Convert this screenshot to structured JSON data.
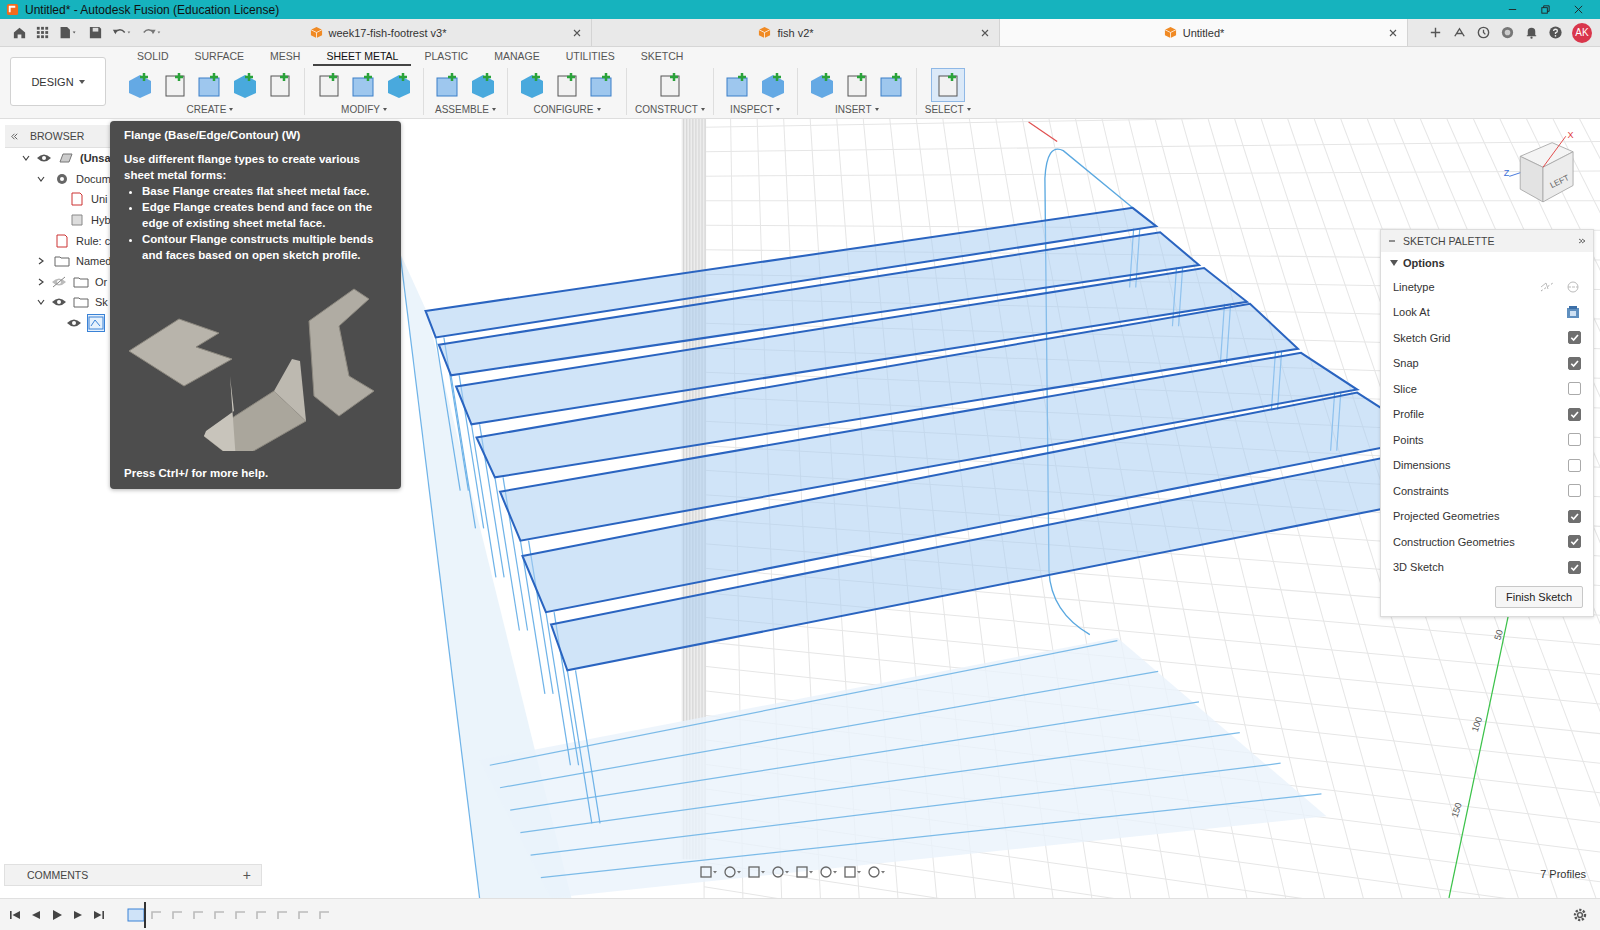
{
  "window": {
    "title": "Untitled* - Autodesk Fusion (Education License)"
  },
  "doc_tabs": [
    {
      "label": "week17-fish-footrest v3*",
      "selected": false
    },
    {
      "label": "fish v2*",
      "selected": false
    },
    {
      "label": "Untitled*",
      "selected": true
    }
  ],
  "user": {
    "initials": "AK"
  },
  "workspace": {
    "label": "DESIGN"
  },
  "toolbar_tabs": [
    {
      "label": "SOLID",
      "selected": false
    },
    {
      "label": "SURFACE",
      "selected": false
    },
    {
      "label": "MESH",
      "selected": false
    },
    {
      "label": "SHEET METAL",
      "selected": true
    },
    {
      "label": "PLASTIC",
      "selected": false
    },
    {
      "label": "MANAGE",
      "selected": false
    },
    {
      "label": "UTILITIES",
      "selected": false
    },
    {
      "label": "SKETCH",
      "selected": false
    }
  ],
  "tool_groups": [
    "CREATE",
    "MODIFY",
    "ASSEMBLE",
    "CONFIGURE",
    "CONSTRUCT",
    "INSPECT",
    "INSERT",
    "SELECT"
  ],
  "browser": {
    "title": "BROWSER",
    "items": [
      {
        "label": "(Unsa",
        "depth": 0,
        "expandable": true,
        "expanded": true,
        "eye": "shown",
        "kind": "component"
      },
      {
        "label": "Docum",
        "depth": 1,
        "expandable": true,
        "expanded": true,
        "eye": "none",
        "kind": "settings"
      },
      {
        "label": "Uni",
        "depth": 2,
        "expandable": false,
        "expanded": false,
        "eye": "none",
        "kind": "units"
      },
      {
        "label": "Hyb",
        "depth": 2,
        "expandable": false,
        "expanded": false,
        "eye": "none",
        "kind": "hybrid"
      },
      {
        "label": "Rule: c",
        "depth": 1,
        "expandable": false,
        "expanded": false,
        "eye": "none",
        "kind": "rule"
      },
      {
        "label": "Named",
        "depth": 1,
        "expandable": true,
        "expanded": false,
        "eye": "none",
        "kind": "folder"
      },
      {
        "label": "Or",
        "depth": 1,
        "expandable": true,
        "expanded": false,
        "eye": "hidden",
        "kind": "folder"
      },
      {
        "label": "Sk",
        "depth": 1,
        "expandable": true,
        "expanded": true,
        "eye": "shown",
        "kind": "folder"
      },
      {
        "label": "",
        "depth": 2,
        "expandable": false,
        "expanded": false,
        "eye": "shown",
        "kind": "sketch"
      }
    ]
  },
  "tooltip": {
    "title": "Flange (Base/Edge/Contour) (W)",
    "intro": "Use different flange types to create various sheet metal forms:",
    "bullets": [
      "Base Flange creates flat sheet metal face.",
      "Edge Flange creates bend and face on the edge of existing sheet metal face.",
      "Contour Flange constructs multiple bends and faces based on open sketch profile."
    ],
    "footer": "Press Ctrl+/ for more help."
  },
  "sketch_palette": {
    "title": "SKETCH PALETTE",
    "section": "Options",
    "section_expanded": true,
    "rows": [
      {
        "label": "Linetype",
        "kind": "icons"
      },
      {
        "label": "Look At",
        "kind": "button"
      },
      {
        "label": "Sketch Grid",
        "kind": "checkbox",
        "checked": true
      },
      {
        "label": "Snap",
        "kind": "checkbox",
        "checked": true
      },
      {
        "label": "Slice",
        "kind": "checkbox",
        "checked": false
      },
      {
        "label": "Profile",
        "kind": "checkbox",
        "checked": true
      },
      {
        "label": "Points",
        "kind": "checkbox",
        "checked": false
      },
      {
        "label": "Dimensions",
        "kind": "checkbox",
        "checked": false
      },
      {
        "label": "Constraints",
        "kind": "checkbox",
        "checked": false
      },
      {
        "label": "Projected Geometries",
        "kind": "checkbox",
        "checked": true
      },
      {
        "label": "Construction Geometries",
        "kind": "checkbox",
        "checked": true
      },
      {
        "label": "3D Sketch",
        "kind": "checkbox",
        "checked": true
      }
    ],
    "finish_button": "Finish Sketch"
  },
  "viewcube": {
    "face": "LEFT",
    "axes": [
      {
        "label": "X",
        "color": "#e03c3c"
      },
      {
        "label": "Z",
        "color": "#3a6fd8"
      }
    ]
  },
  "axis_ticks": [
    "50",
    "100",
    "150"
  ],
  "comments": {
    "title": "COMMENTS",
    "add": "+"
  },
  "status": {
    "profiles": "7 Profiles"
  }
}
